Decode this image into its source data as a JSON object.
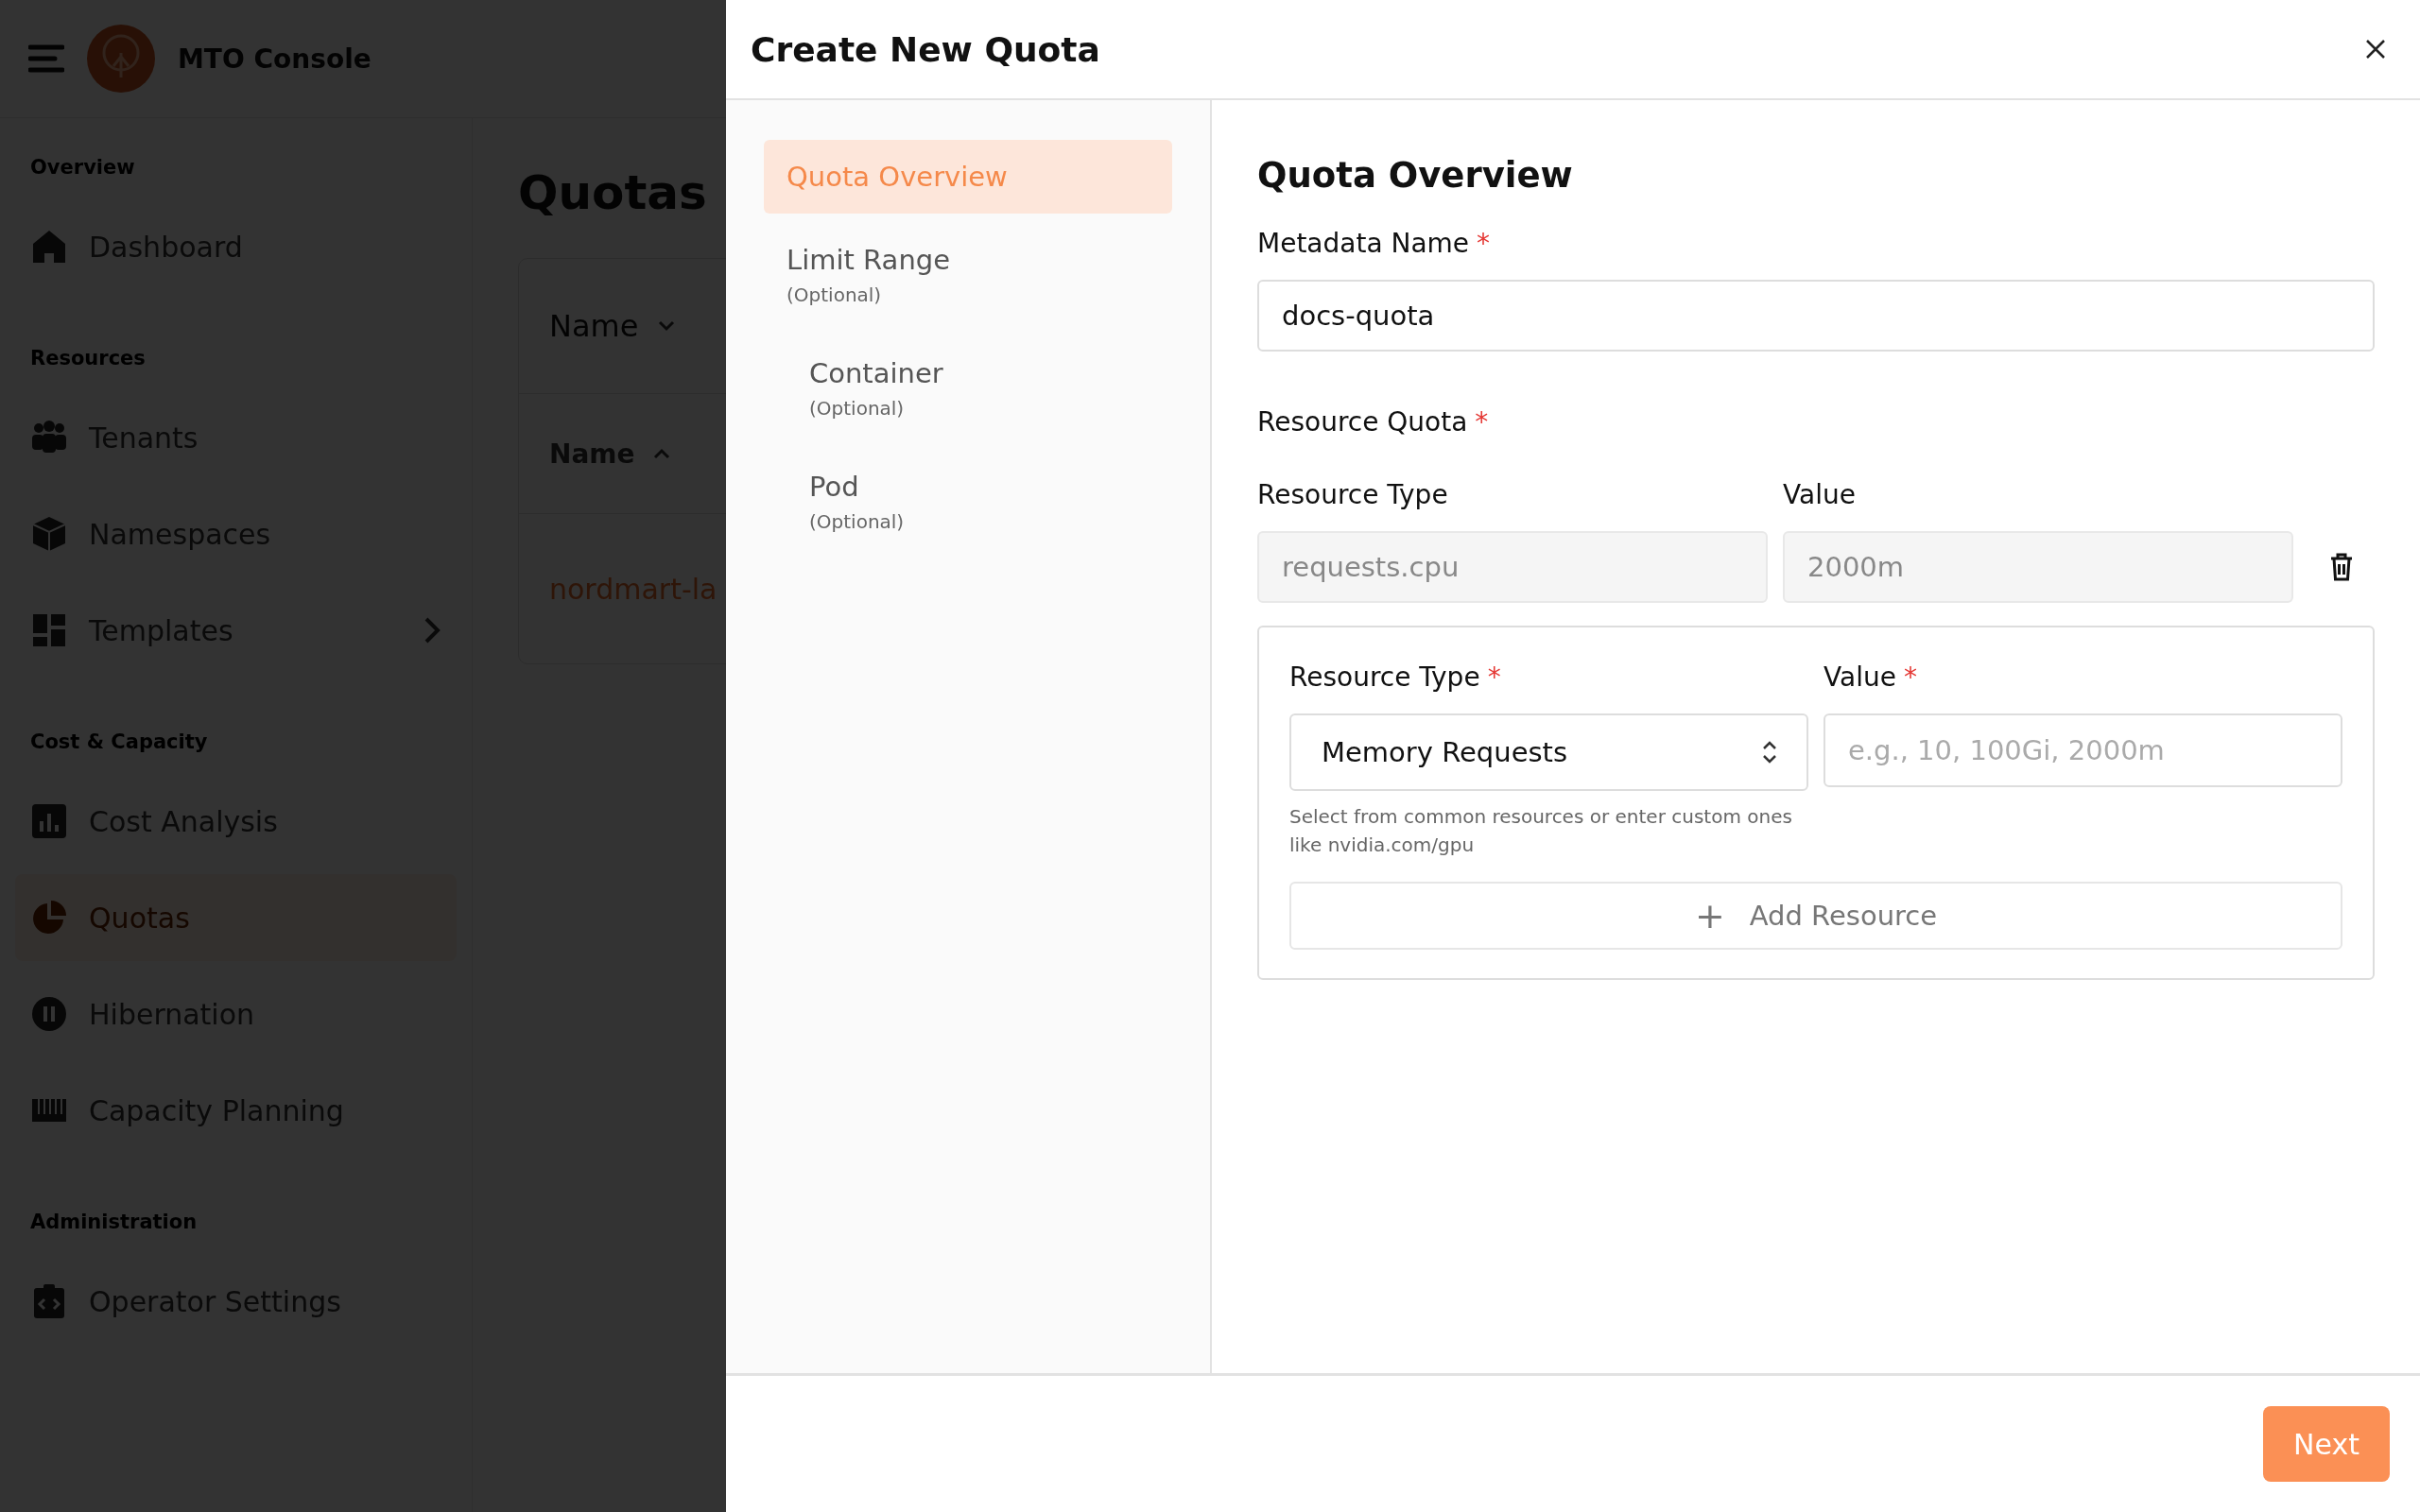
{
  "app": {
    "brand": "MTO Console",
    "sidebar": [
      {
        "title": "Overview",
        "items": [
          {
            "label": "Dashboard",
            "kind": "link",
            "selected": false
          }
        ]
      },
      {
        "title": "Resources",
        "items": [
          {
            "label": "Tenants",
            "kind": "link",
            "selected": false
          },
          {
            "label": "Namespaces",
            "kind": "link",
            "selected": false
          },
          {
            "label": "Templates",
            "kind": "group",
            "selected": false
          }
        ]
      },
      {
        "title": "Cost & Capacity",
        "items": [
          {
            "label": "Cost Analysis",
            "kind": "link",
            "selected": false
          },
          {
            "label": "Quotas",
            "kind": "link",
            "selected": true
          },
          {
            "label": "Hibernation",
            "kind": "link",
            "selected": false
          },
          {
            "label": "Capacity Planning",
            "kind": "link",
            "selected": false
          }
        ]
      },
      {
        "title": "Administration",
        "items": [
          {
            "label": "Operator Settings",
            "kind": "link",
            "selected": false
          }
        ]
      }
    ],
    "page": {
      "title": "Quotas",
      "filter": "Name",
      "column": {
        "label": "Name",
        "sort_ascending": true
      },
      "rows": [
        "nordmart-la"
      ]
    }
  },
  "dialog": {
    "title": "Create New Quota",
    "steps": [
      {
        "label": "Quota Overview",
        "selected": true
      },
      {
        "label": "Limit Range",
        "note": "(Optional)",
        "selected": false,
        "children": [
          {
            "label": "Container",
            "note": "(Optional)",
            "selected": false
          },
          {
            "label": "Pod",
            "note": "(Optional)",
            "selected": false
          }
        ]
      }
    ],
    "heading": "Quota Overview",
    "metadata_name": {
      "label": "Metadata Name",
      "required_mark": "*",
      "value": "docs-quota"
    },
    "resource_quota": {
      "label": "Resource Quota",
      "required_mark": "*",
      "columns": [
        "Resource Type",
        "Value"
      ],
      "rows": [
        {
          "type": "requests.cpu",
          "value": "2000m"
        }
      ],
      "new_entry": {
        "type_label": "Resource Type",
        "type_mark": "*",
        "type_value": "Memory Requests",
        "value_label": "Value",
        "value_mark": "*",
        "value_placeholder": "e.g., 10, 100Gi, 2000m",
        "helper": "Select from common resources or enter custom ones like nvidia.com/gpu",
        "add_button": {
          "icon": "+",
          "label": "Add Resource"
        }
      }
    },
    "next_button": "Next"
  }
}
